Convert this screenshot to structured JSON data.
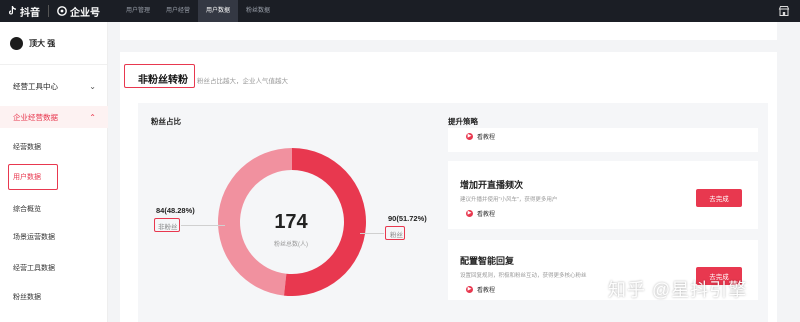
{
  "topbar": {
    "brand_douyin": "抖音",
    "brand_enterprise": "企业号",
    "nav": [
      "用户管理",
      "用户经营",
      "用户数据",
      "粉丝数据"
    ],
    "active_index": 2,
    "right_icon": "shop-icon"
  },
  "sidebar": {
    "username": "顶大 强",
    "groups": {
      "tools_center": "经营工具中心",
      "enterprise_data": "企业经营数据"
    },
    "items": [
      "经营数据",
      "用户数据",
      "综合概览",
      "场景运营数据",
      "经营工具数据",
      "粉丝数据"
    ],
    "selected_index": 1
  },
  "section": {
    "title": "非粉丝转粉",
    "subtitle": "粉丝占比越大，企业人气值越大",
    "fans_ratio_title": "粉丝占比",
    "strategy_title": "提升策略"
  },
  "chart_data": {
    "type": "pie",
    "title": "粉丝占比",
    "center_value": "174",
    "center_label": "粉丝总数(人)",
    "slices": [
      {
        "label": "非粉丝",
        "value": 84,
        "display": "84(48.28%)",
        "color": "#f1919f"
      },
      {
        "label": "粉丝",
        "value": 90,
        "display": "90(51.72%)",
        "color": "#e8384f"
      }
    ]
  },
  "strategies": [
    {
      "title": "",
      "desc": "",
      "tutorial": "看教程",
      "button": ""
    },
    {
      "title": "增加开直播频次",
      "desc": "建议升播并使用\"小风车\"，获得更多用户",
      "tutorial": "看教程",
      "button": "去完成"
    },
    {
      "title": "配置智能回复",
      "desc": "设置回复规则，积极和粉丝互动，获得更多核心粉丝",
      "tutorial": "看教程",
      "button": "去完成"
    }
  ],
  "watermark": "知乎 @星抖引擎",
  "colors": {
    "accent": "#e8384f",
    "accent_light": "#f1919f",
    "topbar": "#1b1e25"
  }
}
